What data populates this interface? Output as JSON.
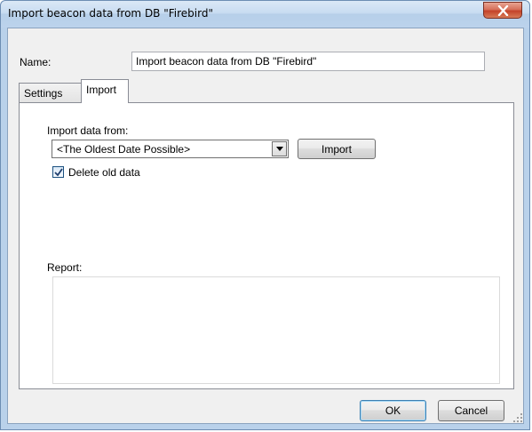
{
  "window": {
    "title": "Import beacon data from DB \"Firebird\"",
    "close_icon": "close-icon"
  },
  "form": {
    "name_label": "Name:",
    "name_value": "Import beacon data from DB \"Firebird\""
  },
  "tabs": [
    {
      "label": "Settings",
      "selected": false
    },
    {
      "label": "Import",
      "selected": true
    }
  ],
  "import_tab": {
    "import_from_label": "Import data from:",
    "import_from_value": "<The Oldest Date Possible>",
    "import_button_label": "Import",
    "delete_old_data_label": "Delete old data",
    "delete_old_data_checked": true,
    "report_label": "Report:",
    "report_text": ""
  },
  "footer": {
    "ok_label": "OK",
    "cancel_label": "Cancel"
  },
  "colors": {
    "frame": "#b9d1ea",
    "close_button": "#c4432a",
    "checkmark": "#1f3e6d"
  }
}
